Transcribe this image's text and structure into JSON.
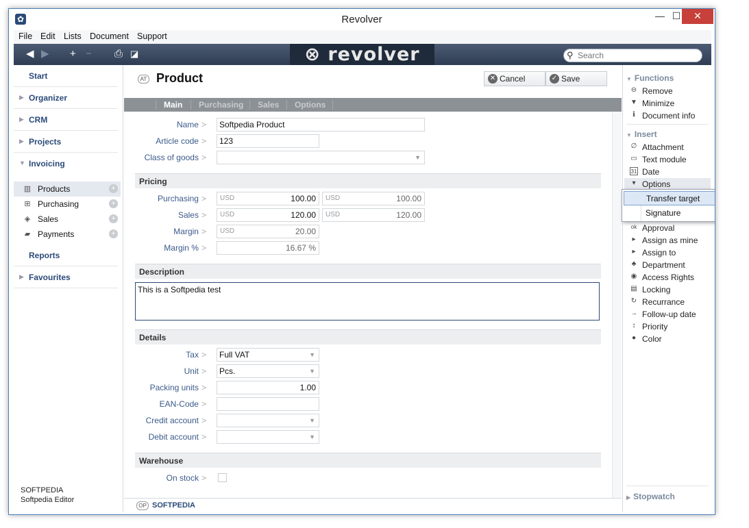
{
  "window": {
    "title": "Revolver",
    "minimize": "—",
    "maximize": "☐",
    "close": "✕"
  },
  "menu": [
    "File",
    "Edit",
    "Lists",
    "Document",
    "Support"
  ],
  "toolbar": {
    "logo": "⊗ revolver",
    "search_placeholder": "Search"
  },
  "sidebar": {
    "sections": [
      {
        "label": "Start",
        "arrow": ""
      },
      {
        "label": "Organizer",
        "arrow": "▶"
      },
      {
        "label": "CRM",
        "arrow": "▶"
      },
      {
        "label": "Projects",
        "arrow": "▶"
      },
      {
        "label": "Invoicing",
        "arrow": "▼"
      }
    ],
    "invoicing_items": [
      {
        "label": "Products",
        "icon": "barcode-icon"
      },
      {
        "label": "Purchasing",
        "icon": "cart-icon"
      },
      {
        "label": "Sales",
        "icon": "tag-icon"
      },
      {
        "label": "Payments",
        "icon": "money-icon"
      }
    ],
    "bottom_sections": [
      {
        "label": "Reports",
        "arrow": ""
      },
      {
        "label": "Favourites",
        "arrow": "▶"
      }
    ],
    "user": {
      "company": "SOFTPEDIA",
      "name": "Softpedia Editor"
    }
  },
  "document": {
    "badge": "AT",
    "title": "Product",
    "cancel_label": "Cancel",
    "save_label": "Save",
    "tabs": [
      "Main",
      "Purchasing",
      "Sales",
      "Options"
    ]
  },
  "form": {
    "name_label": "Name",
    "name_value": "Softpedia Product",
    "article_label": "Article code",
    "article_value": "123",
    "class_label": "Class of goods",
    "class_value": "",
    "pricing_head": "Pricing",
    "purchasing_label": "Purchasing",
    "purchasing_cur": "USD",
    "purchasing_value": "100.00",
    "purchasing_cur2": "USD",
    "purchasing_value2": "100.00",
    "sales_label": "Sales",
    "sales_cur": "USD",
    "sales_value": "120.00",
    "sales_cur2": "USD",
    "sales_value2": "120.00",
    "margin_label": "Margin",
    "margin_cur": "USD",
    "margin_value": "20.00",
    "marginp_label": "Margin %",
    "marginp_value": "16.67 %",
    "description_head": "Description",
    "description_value": "This is a Softpedia test",
    "details_head": "Details",
    "tax_label": "Tax",
    "tax_value": "Full VAT",
    "unit_label": "Unit",
    "unit_value": "Pcs.",
    "packing_label": "Packing units",
    "packing_value": "1.00",
    "ean_label": "EAN-Code",
    "ean_value": "",
    "credit_label": "Credit account",
    "credit_value": "",
    "debit_label": "Debit account",
    "debit_value": "",
    "warehouse_head": "Warehouse",
    "stock_label": "On stock"
  },
  "footer": {
    "badge": "OP",
    "label": "SOFTPEDIA"
  },
  "rightbar": {
    "functions_head": "Functions",
    "functions": [
      {
        "label": "Remove",
        "icon": "⊖"
      },
      {
        "label": "Minimize",
        "icon": "▼"
      },
      {
        "label": "Document info",
        "icon": "ℹ"
      }
    ],
    "insert_head": "Insert",
    "insert": [
      {
        "label": "Attachment",
        "icon": "∅"
      },
      {
        "label": "Text module",
        "icon": "▭"
      },
      {
        "label": "Date",
        "icon": "31"
      },
      {
        "label": "Options",
        "icon": "▾"
      }
    ],
    "more": [
      {
        "label": "Approval",
        "icon": "ok"
      },
      {
        "label": "Assign as mine",
        "icon": "▸"
      },
      {
        "label": "Assign to",
        "icon": "▸"
      },
      {
        "label": "Department",
        "icon": "♣"
      },
      {
        "label": "Access Rights",
        "icon": "◉"
      },
      {
        "label": "Locking",
        "icon": "▤"
      },
      {
        "label": "Recurrance",
        "icon": "↻"
      },
      {
        "label": "Follow-up date",
        "icon": "→"
      },
      {
        "label": "Priority",
        "icon": "↕"
      },
      {
        "label": "Color",
        "icon": "●"
      }
    ],
    "stopwatch_head": "Stopwatch"
  },
  "popup": [
    "Transfer target",
    "Signature"
  ]
}
